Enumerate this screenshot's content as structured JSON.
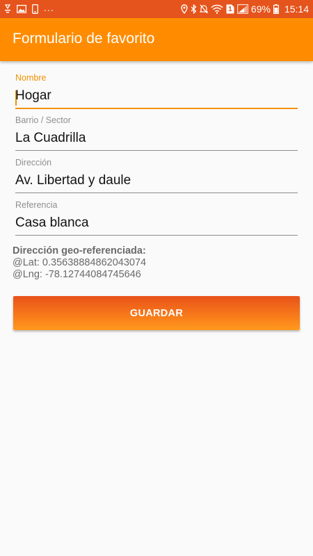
{
  "colors": {
    "status_bar": "#e5541c",
    "app_bar": "#ff8c00",
    "accent": "#f39200",
    "button_top": "#e8521a",
    "button_bottom": "#ff9a1c",
    "background": "#fafafa"
  },
  "status_bar": {
    "icons_left": [
      "usb-debug-icon",
      "image-icon",
      "phone-icon"
    ],
    "more": "...",
    "icons_right": [
      "location-icon",
      "bluetooth-icon",
      "mute-icon",
      "wifi-icon",
      "sim-icon",
      "signal-icon",
      "battery-icon"
    ],
    "sim_number": "1",
    "battery": "69%",
    "time": "15:14"
  },
  "app_bar": {
    "title": "Formulario de favorito"
  },
  "form": {
    "fields": [
      {
        "label": "Nombre",
        "value": "Hogar"
      },
      {
        "label": "Barrio / Sector",
        "value": "La Cuadrilla"
      },
      {
        "label": "Dirección",
        "value": "Av. Libertad y daule"
      },
      {
        "label": "Referencia",
        "value": "Casa blanca"
      }
    ],
    "focused_field": "Nombre"
  },
  "geo": {
    "title": "Dirección geo-referenciada:",
    "lat": "@Lat: 0.35638884862043074",
    "lng": "@Lng: -78.12744084745646"
  },
  "actions": {
    "save_label": "GUARDAR"
  }
}
